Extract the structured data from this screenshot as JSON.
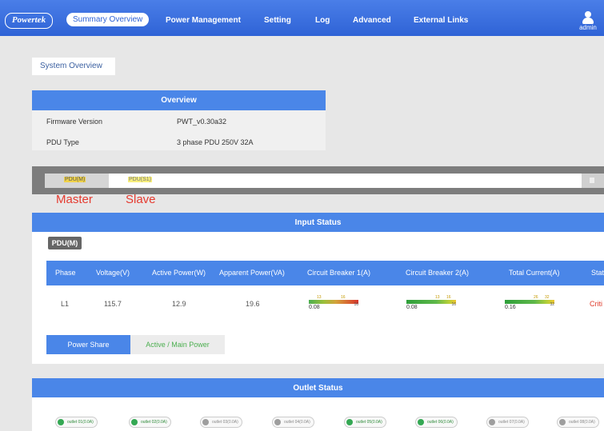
{
  "nav": {
    "logo": "Powertek",
    "items": [
      "Summary Overview",
      "Power Management",
      "Setting",
      "Log",
      "Advanced",
      "External Links"
    ],
    "user": "admin"
  },
  "system_tab": "System Overview",
  "overview": {
    "title": "Overview",
    "rows": [
      {
        "label": "Firmware Version",
        "value": "PWT_v0.30a32"
      },
      {
        "label": "PDU Type",
        "value": "3 phase PDU 250V 32A"
      }
    ]
  },
  "pdu_tabs": {
    "master_tab": "PDU(M)",
    "slave_tab": "PDU(S1)"
  },
  "annotations": {
    "master": "Master",
    "slave": "Slave"
  },
  "input_status": {
    "title": "Input Status",
    "pdu_label": "PDU(M)",
    "columns": [
      "Phase",
      "Voltage(V)",
      "Active Power(W)",
      "Apparent Power(VA)",
      "Circuit Breaker 1(A)",
      "Circuit Breaker 2(A)",
      "Total Current(A)",
      "Stat"
    ],
    "row": {
      "phase": "L1",
      "voltage": "115.7",
      "active_power": "12.9",
      "apparent_power": "19.6",
      "cb1": {
        "value": "0.08",
        "warn": "13",
        "crit": "16",
        "max": "16"
      },
      "cb2": {
        "value": "0.08",
        "warn": "13",
        "crit": "16",
        "max": "16"
      },
      "total": {
        "value": "0.16",
        "warn": "26",
        "crit": "32",
        "max": "32"
      },
      "status": "Criti"
    },
    "tabs": {
      "power_share": "Power Share",
      "active_main": "Active / Main Power"
    }
  },
  "outlet_status": {
    "title": "Outlet Status",
    "outlets": [
      {
        "label": "outlet 01(0.0A)",
        "state": "on"
      },
      {
        "label": "outlet 02(0.0A)",
        "state": "on"
      },
      {
        "label": "outlet 03(0.0A)",
        "state": "off"
      },
      {
        "label": "outlet 04(0.0A)",
        "state": "off"
      },
      {
        "label": "outlet 05(0.0A)",
        "state": "on"
      },
      {
        "label": "outlet 06(0.0A)",
        "state": "on"
      },
      {
        "label": "outlet 07(0.0A)",
        "state": "off"
      },
      {
        "label": "outlet 08(0.0A)",
        "state": "off"
      }
    ]
  },
  "colors": {
    "accent": "#4a86e8",
    "critical": "#e03c2c",
    "ok": "#34a853"
  }
}
